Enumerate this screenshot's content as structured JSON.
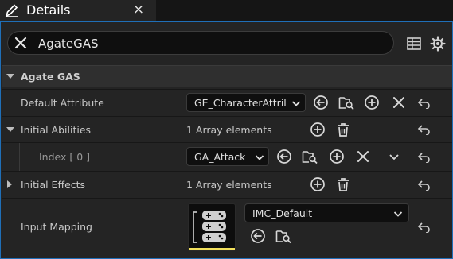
{
  "tab": {
    "title": "Details",
    "close_glyph": "×",
    "icon": "pencil-icon"
  },
  "search": {
    "value": "AgateGAS",
    "placeholder": "Search"
  },
  "toolbar": {
    "table_icon": "table-icon",
    "settings_icon": "gear-icon"
  },
  "category": {
    "label": "Agate GAS"
  },
  "rows": {
    "default_attribute": {
      "label": "Default Attribute",
      "value": "GE_CharacterAttril"
    },
    "initial_abilities": {
      "label": "Initial Abilities",
      "count_text": "1 Array elements"
    },
    "index0": {
      "label": "Index [ 0 ]",
      "value": "GA_Attack"
    },
    "initial_effects": {
      "label": "Initial Effects",
      "count_text": "1 Array elements"
    },
    "input_mapping": {
      "label": "Input Mapping",
      "value": "IMC_Default"
    }
  },
  "colors": {
    "accent_border": "#1f6fb8",
    "thumbnail_bar": "#f2e05c",
    "panel_bg": "#242424"
  }
}
